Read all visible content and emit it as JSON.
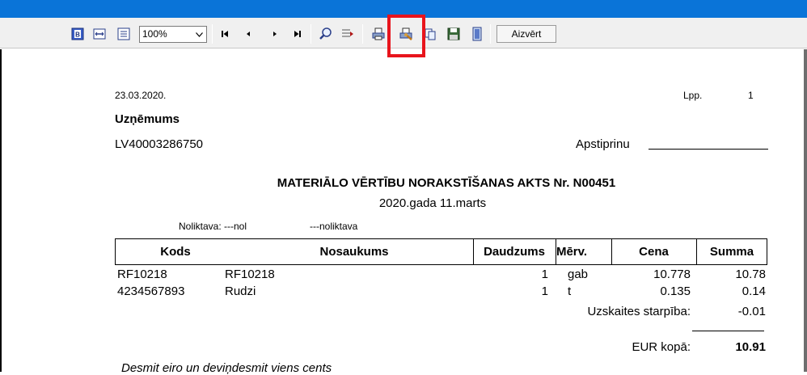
{
  "toolbar": {
    "zoom_value": "100%",
    "close_label": "Aizvērt",
    "icons": [
      "page-view-icon",
      "fit-width-icon",
      "fit-page-icon",
      "first-page-icon",
      "prev-page-icon",
      "next-page-icon",
      "last-page-icon",
      "search-icon",
      "find-next-icon",
      "print-icon",
      "print-setup-icon",
      "copy-icon",
      "save-icon",
      "export-icon"
    ]
  },
  "report": {
    "date": "23.03.2020.",
    "page_label": "Lpp.",
    "page_number": "1",
    "company": "Uzņēmums",
    "reg_number": "LV40003286750",
    "approve_label": "Apstiprinu",
    "title": "MATERIĀLO VĒRTĪBU NORAKSTĪŠANAS AKTS Nr.  N00451",
    "subtitle": "2020.gada 11.marts",
    "warehouse_label": "Noliktava: ---nol",
    "warehouse_name": "---noliktava",
    "columns": [
      "Kods",
      "Nosaukums",
      "Daudzums",
      "Mērv.",
      "Cena",
      "Summa"
    ],
    "rows": [
      {
        "code": "RF10218",
        "name": "RF10218",
        "qty": "1",
        "unit": "gab",
        "price": "10.778",
        "sum": "10.78"
      },
      {
        "code": "4234567893",
        "name": "Rudzi",
        "qty": "1",
        "unit": "t",
        "price": "0.135",
        "sum": "0.14"
      }
    ],
    "diff_label": "Uzskaites starpība:",
    "diff_value": "-0.01",
    "total_label": "EUR kopā:",
    "total_value": "10.91",
    "words": "Desmit eiro un deviņdesmit viens cents"
  }
}
